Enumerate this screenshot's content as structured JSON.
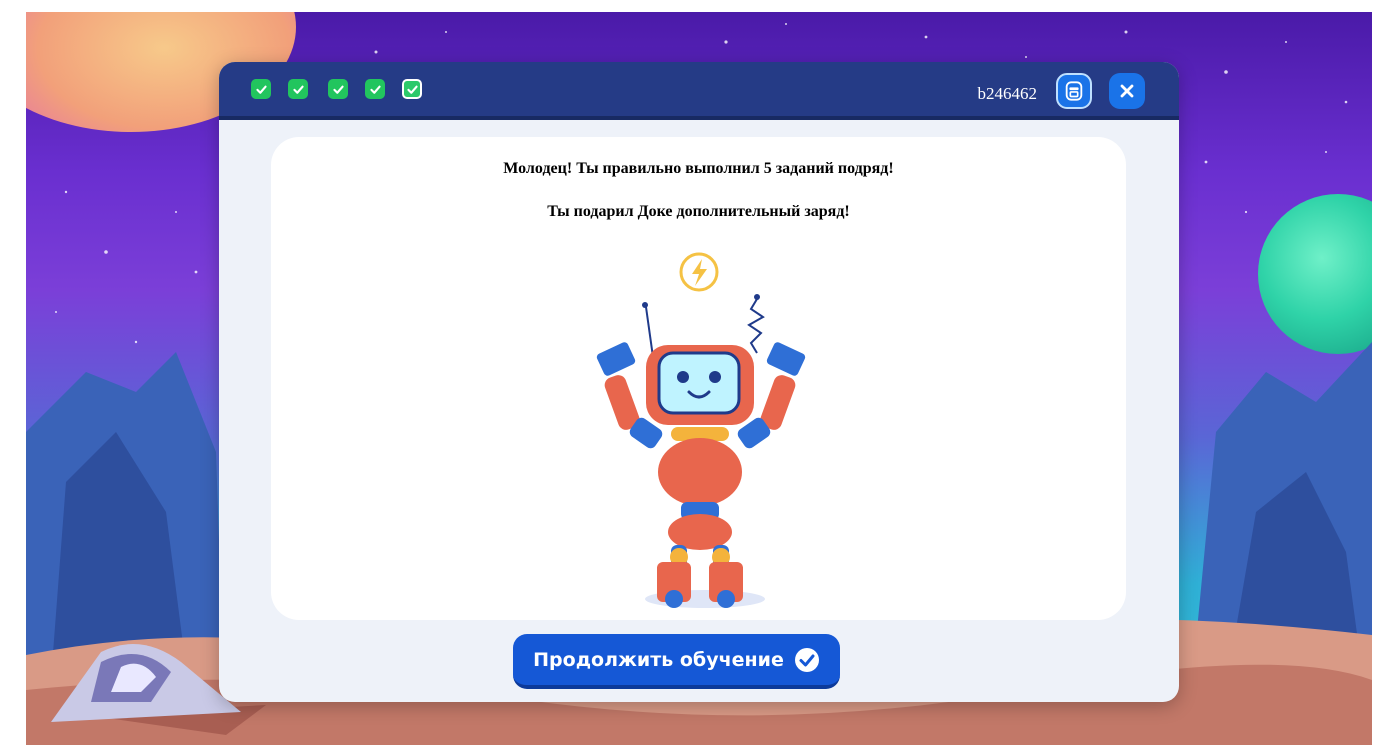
{
  "header": {
    "task_id": "b246462",
    "progress_checks": [
      {
        "state": "done"
      },
      {
        "state": "done"
      },
      {
        "state": "done"
      },
      {
        "state": "done"
      },
      {
        "state": "current"
      }
    ],
    "icons": {
      "print": "printer-icon",
      "close": "close-icon"
    }
  },
  "content": {
    "message_line1": "Молодец! Ты правильно выполнил 5 заданий подряд!",
    "message_line2": "Ты подарил Доке дополнительный заряд!",
    "illustration": "robot-with-lightning-icon"
  },
  "footer": {
    "continue_label": "Продолжить обучение"
  },
  "colors": {
    "header_bg": "#253b86",
    "check_green": "#22c55e",
    "button_blue": "#1558d6",
    "card_bg": "#ffffff",
    "modal_bg": "#eef2f9"
  }
}
